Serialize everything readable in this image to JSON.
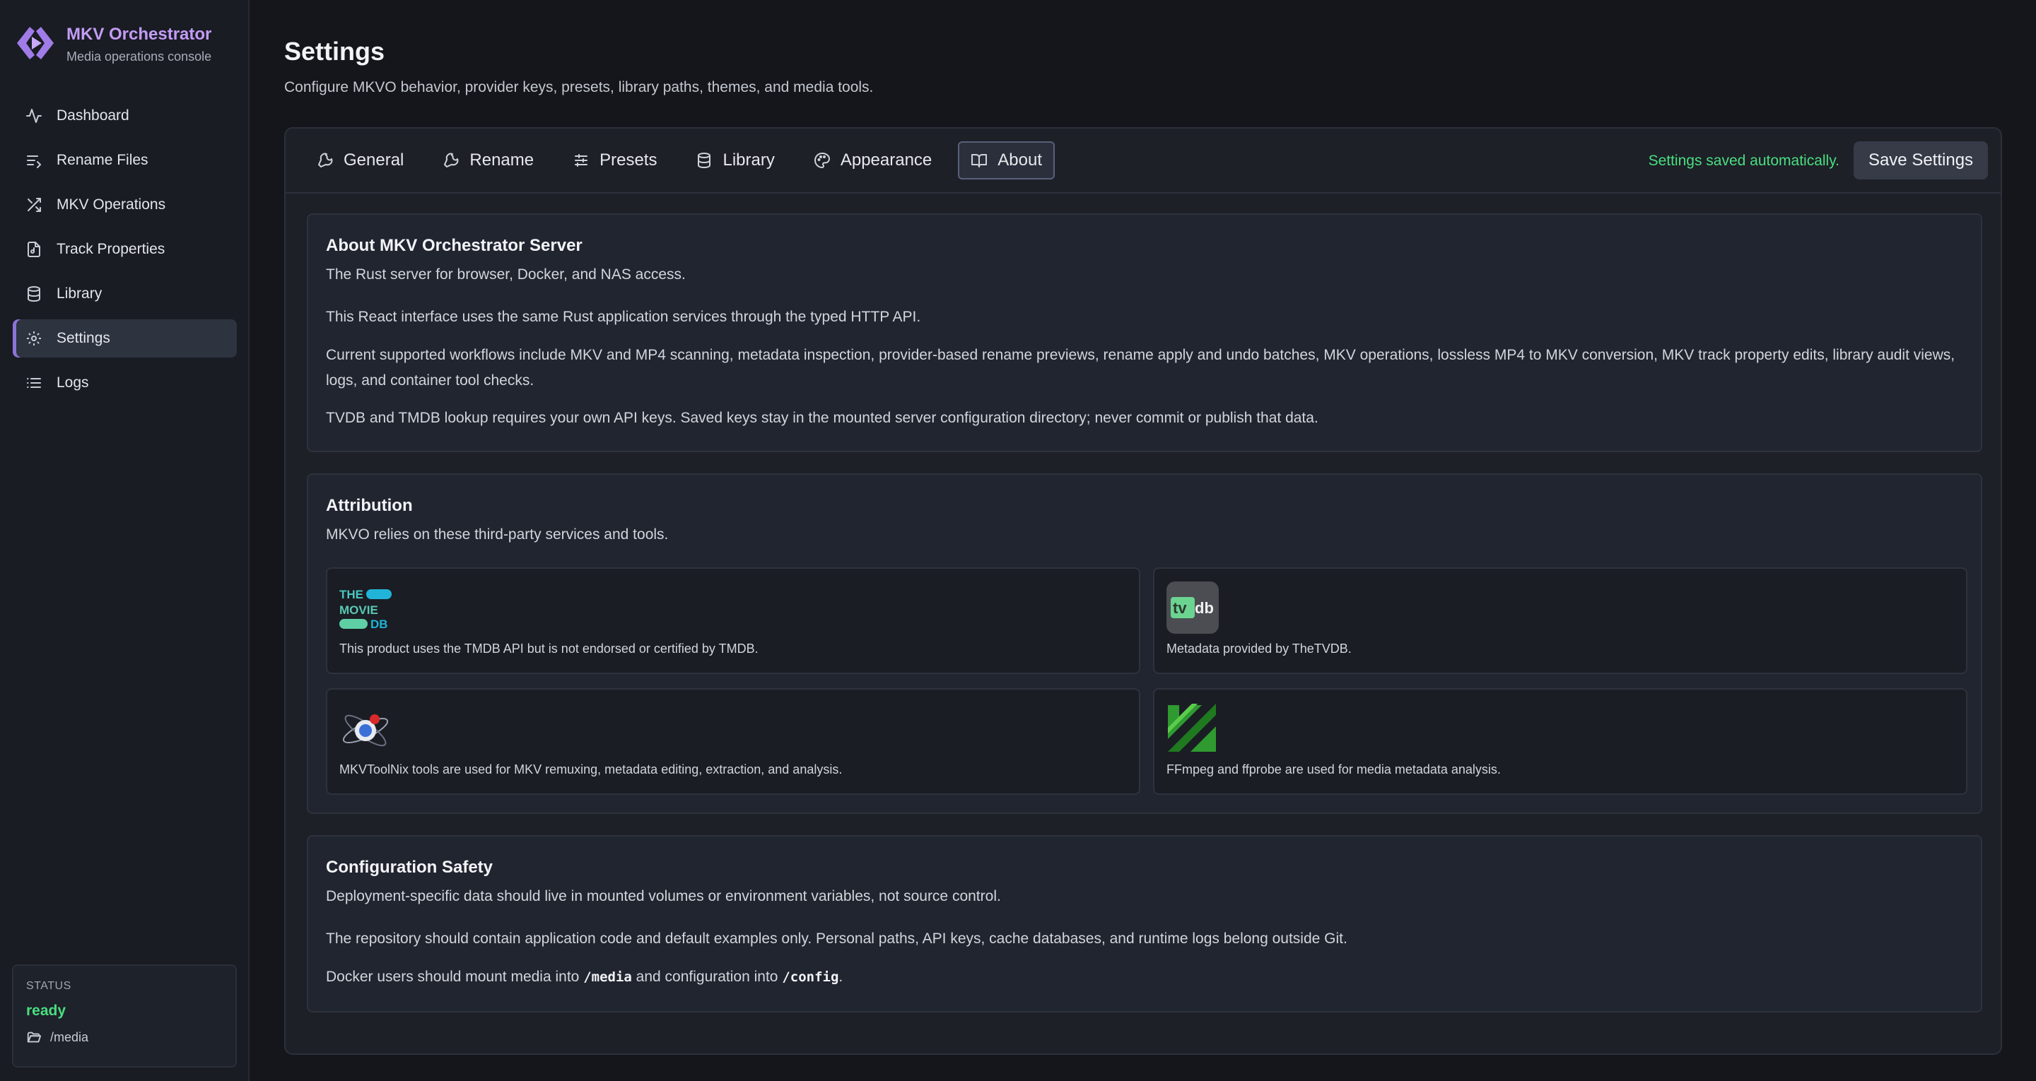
{
  "brand": {
    "title": "MKV Orchestrator",
    "subtitle": "Media operations console"
  },
  "nav": [
    {
      "label": "Dashboard",
      "icon": "activity-icon"
    },
    {
      "label": "Rename Files",
      "icon": "rename-list-icon"
    },
    {
      "label": "MKV Operations",
      "icon": "shuffle-icon"
    },
    {
      "label": "Track Properties",
      "icon": "file-audio-icon"
    },
    {
      "label": "Library",
      "icon": "database-icon"
    },
    {
      "label": "Settings",
      "icon": "gear-icon",
      "active": true
    },
    {
      "label": "Logs",
      "icon": "list-icon"
    }
  ],
  "status": {
    "label": "STATUS",
    "value": "ready",
    "path": "/media"
  },
  "page": {
    "title": "Settings",
    "subtitle": "Configure MKVO behavior, provider keys, presets, library paths, themes, and media tools."
  },
  "tabs": [
    {
      "label": "General",
      "icon": "wrench-icon"
    },
    {
      "label": "Rename",
      "icon": "wrench-icon"
    },
    {
      "label": "Presets",
      "icon": "sliders-icon"
    },
    {
      "label": "Library",
      "icon": "database-icon"
    },
    {
      "label": "Appearance",
      "icon": "palette-icon"
    },
    {
      "label": "About",
      "icon": "book-icon",
      "active": true
    }
  ],
  "save": {
    "status": "Settings saved automatically.",
    "button": "Save Settings"
  },
  "about": {
    "title": "About MKV Orchestrator Server",
    "p1": "The Rust server for browser, Docker, and NAS access.",
    "p2": "This React interface uses the same Rust application services through the typed HTTP API.",
    "p3": "Current supported workflows include MKV and MP4 scanning, metadata inspection, provider-based rename previews, rename apply and undo batches, MKV operations, lossless MP4 to MKV conversion, MKV track property edits, library audit views, logs, and container tool checks.",
    "p4": "TVDB and TMDB lookup requires your own API keys. Saved keys stay in the mounted server configuration directory; never commit or publish that data."
  },
  "attribution": {
    "title": "Attribution",
    "intro": "MKVO relies on these third-party services and tools.",
    "cards": [
      {
        "caption": "This product uses the TMDB API but is not endorsed or certified by TMDB.",
        "logo_text": [
          "THE",
          "MOVIE",
          "DB"
        ]
      },
      {
        "caption": "Metadata provided by TheTVDB.",
        "logo_text": [
          "tv",
          "db"
        ]
      },
      {
        "caption": "MKVToolNix tools are used for MKV remuxing, metadata editing, extraction, and analysis."
      },
      {
        "caption": "FFmpeg and ffprobe are used for media metadata analysis."
      }
    ]
  },
  "safety": {
    "title": "Configuration Safety",
    "p1": "Deployment-specific data should live in mounted volumes or environment variables, not source control.",
    "p2": "The repository should contain application code and default examples only. Personal paths, API keys, cache databases, and runtime logs belong outside Git.",
    "p3_a": "Docker users should mount media into ",
    "p3_code1": "/media",
    "p3_b": " and configuration into ",
    "p3_code2": "/config",
    "p3_c": "."
  },
  "colors": {
    "accent": "#c39cf6",
    "success": "#4ade80",
    "background": "#14161b"
  }
}
